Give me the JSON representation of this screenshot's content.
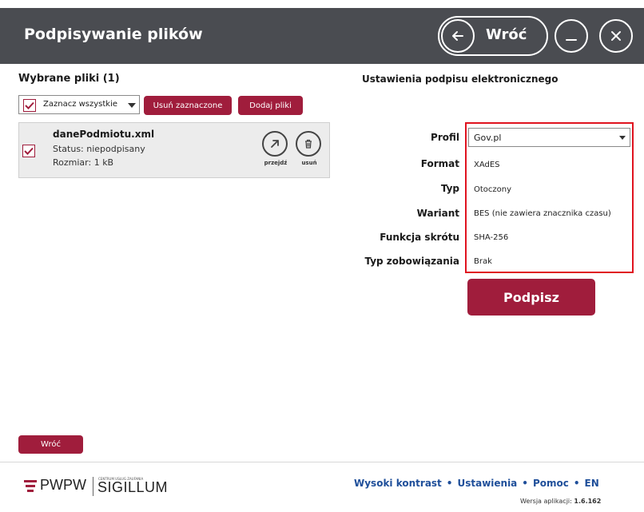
{
  "header": {
    "title": "Podpisywanie plików",
    "back_label": "Wróć"
  },
  "files": {
    "heading": "Wybrane pliki  (1)",
    "select_all_label": "Zaznacz wszystkie",
    "remove_selected_label": "Usuń zaznaczone",
    "add_files_label": "Dodaj pliki",
    "items": [
      {
        "name": "danePodmiotu.xml",
        "status": "Status: niepodpisany",
        "size": "Rozmiar: 1 kB",
        "go_label": "przejdź",
        "delete_label": "usuń"
      }
    ],
    "back_button_label": "Wróć"
  },
  "settings": {
    "heading": "Ustawienia podpisu elektronicznego",
    "labels": {
      "profile": "Profil",
      "format": "Format",
      "type": "Typ",
      "variant": "Wariant",
      "hash": "Funkcja skrótu",
      "commitment": "Typ zobowiązania"
    },
    "values": {
      "profile": "Gov.pl",
      "format": "XAdES",
      "type": "Otoczony",
      "variant": "BES (nie zawiera znacznika czasu)",
      "hash": "SHA-256",
      "commitment": "Brak"
    },
    "sign_label": "Podpisz"
  },
  "footer": {
    "logo_pwpw": "PWPW",
    "logo_small": "CENTRUM USŁUG ZAUFANIA",
    "logo_sigillum": "SIGILLUM",
    "links": [
      "Wysoki kontrast",
      "Ustawienia",
      "Pomoc",
      "EN"
    ],
    "version_label": "Wersja aplikacji:",
    "version_value": "1.6.162"
  },
  "colors": {
    "header_bg": "#4a4c51",
    "accent": "#a01d3c",
    "highlight_border": "#e0131f",
    "link": "#1f4f9a"
  },
  "icons": [
    "arrow-left-icon",
    "minimize-icon",
    "close-icon",
    "checkbox-checked-icon",
    "arrow-up-right-icon",
    "trash-icon",
    "chevron-down-icon"
  ]
}
